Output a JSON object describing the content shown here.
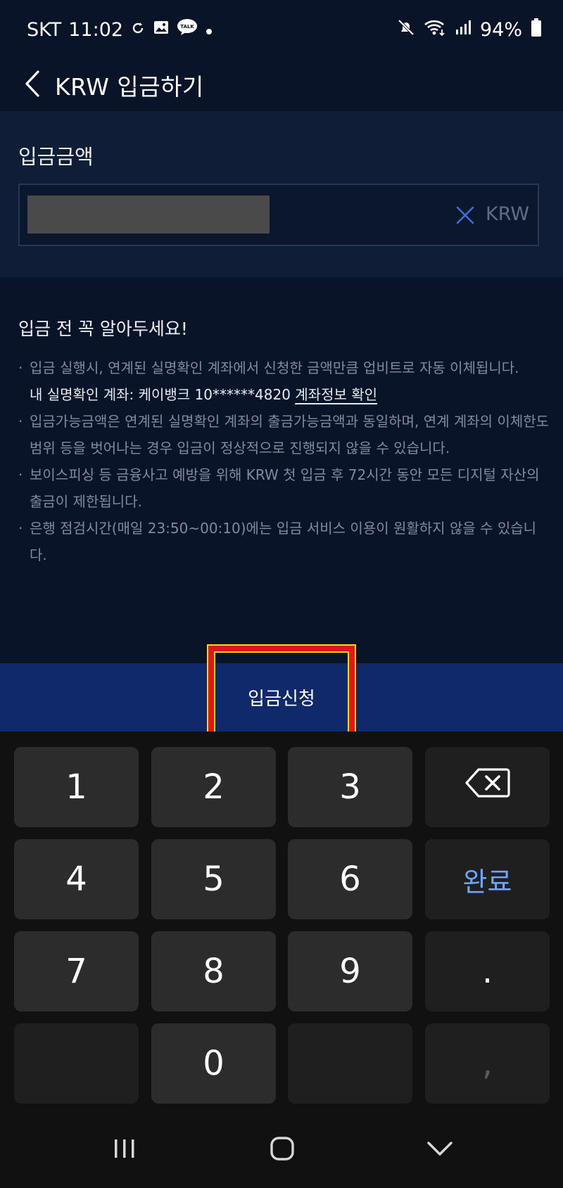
{
  "status_bar": {
    "carrier": "SKT",
    "time": "11:02",
    "battery": "94%",
    "left_icons": [
      "sync-icon",
      "gallery-icon",
      "talk-icon",
      "dot-icon"
    ],
    "right_icons": [
      "mute-icon",
      "wifi-icon",
      "signal-icon",
      "battery-icon"
    ]
  },
  "app_bar": {
    "title": "KRW 입금하기"
  },
  "amount": {
    "label": "입금금액",
    "value": "",
    "currency": "KRW"
  },
  "notice": {
    "title": "입금 전 꼭 알아두세요!",
    "items": [
      "입금 실행시, 연계된 실명확인 계좌에서 신청한 금액만큼 업비트로 자동 이체됩니다.",
      "입금가능금액은 연계된 실명확인 계좌의 출금가능금액과 동일하며, 연계 계좌의 이체한도 범위 등을 벗어나는 경우 입금이 정상적으로 진행되지 않을 수 있습니다.",
      "보이스피싱 등 금융사고 예방을 위해 KRW 첫 입금 후 72시간 동안 모든 디지털 자산의 출금이 제한됩니다.",
      "은행 점검시간(매일 23:50~00:10)에는 입금 서비스 이용이 원활하지 않을 수 있습니다."
    ],
    "account_prefix": "내 실명확인 계좌: 케이뱅크 10******4820",
    "account_link": "계좌정보 확인"
  },
  "submit": {
    "label": "입금신청"
  },
  "keypad": {
    "keys": [
      "1",
      "2",
      "3",
      "",
      "4",
      "5",
      "6",
      "완료",
      "7",
      "8",
      "9",
      ".",
      "",
      "0",
      "",
      ","
    ],
    "done_label": "완료"
  },
  "colors": {
    "background": "#0a1428",
    "panel": "#0f1d36",
    "submit_bar": "#10296b",
    "highlight": "#e3141b",
    "accent_blue": "#6ea3ff"
  }
}
